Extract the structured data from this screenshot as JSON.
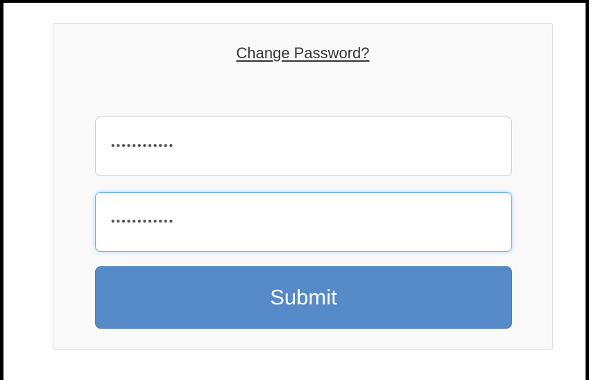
{
  "form": {
    "change_password_link": "Change Password?",
    "password_field_1": {
      "value": "••••••••••••",
      "type": "password"
    },
    "password_field_2": {
      "value": "••••••••••••",
      "type": "password",
      "focused": true
    },
    "submit_label": "Submit"
  },
  "colors": {
    "submit_background": "#5589c7",
    "focus_border": "#66afe9",
    "card_background": "#f9f9f9"
  }
}
